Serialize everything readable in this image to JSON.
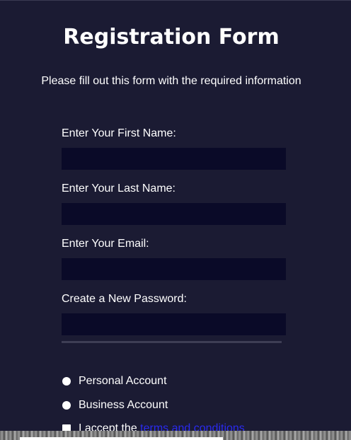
{
  "form": {
    "title": "Registration Form",
    "subtitle": "Please fill out this form with the required information",
    "fields": [
      {
        "label": "Enter Your First Name:",
        "value": ""
      },
      {
        "label": "Enter Your Last Name:",
        "value": ""
      },
      {
        "label": "Enter Your Email:",
        "value": ""
      },
      {
        "label": "Create a New Password:",
        "value": ""
      }
    ],
    "account_types": [
      {
        "label": "Personal Account"
      },
      {
        "label": "Business Account"
      }
    ],
    "terms": {
      "prefix": "I accept the ",
      "link_text": "terms and conditions"
    }
  },
  "colors": {
    "background": "#1b1b33",
    "input_background": "#0a0a28",
    "link": "#2a2aee",
    "text": "#ffffff"
  }
}
